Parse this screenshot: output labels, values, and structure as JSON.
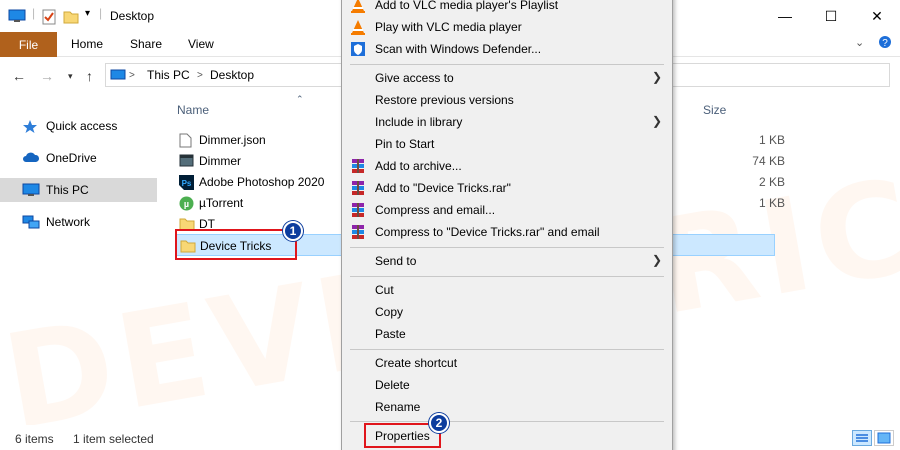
{
  "window": {
    "title": "Desktop",
    "min": "—",
    "max": "☐",
    "close": "✕"
  },
  "ribbon": {
    "tabs": [
      "File",
      "Home",
      "Share",
      "View"
    ]
  },
  "address": {
    "crumbs": [
      "This PC",
      "Desktop"
    ],
    "sep": ">"
  },
  "nav_pane": {
    "items": [
      "Quick access",
      "OneDrive",
      "This PC",
      "Network"
    ],
    "selected": "This PC"
  },
  "columns": {
    "name": "Name",
    "size": "Size"
  },
  "files": [
    {
      "name": "Dimmer.json",
      "size": "1 KB",
      "icon": "document-icon"
    },
    {
      "name": "Dimmer",
      "size": "74 KB",
      "icon": "app-icon"
    },
    {
      "name": "Adobe Photoshop 2020",
      "size": "2 KB",
      "icon": "photoshop-icon"
    },
    {
      "name": "µTorrent",
      "size": "1 KB",
      "icon": "utorrent-icon"
    },
    {
      "name": "DT",
      "size": "",
      "icon": "folder-icon"
    },
    {
      "name": "Device Tricks",
      "size": "",
      "icon": "folder-icon"
    }
  ],
  "selected_file": "Device Tricks",
  "status": {
    "items": "6 items",
    "selected": "1 item selected"
  },
  "context_menu": {
    "items": [
      {
        "label": "Add to VLC media player's Playlist",
        "icon": "vlc-icon",
        "submenu": false
      },
      {
        "label": "Play with VLC media player",
        "icon": "vlc-icon",
        "submenu": false
      },
      {
        "label": "Scan with Windows Defender...",
        "icon": "defender-icon",
        "submenu": false
      },
      {
        "label": "Give access to",
        "icon": "",
        "submenu": true
      },
      {
        "label": "Restore previous versions",
        "icon": "",
        "submenu": false
      },
      {
        "label": "Include in library",
        "icon": "",
        "submenu": true
      },
      {
        "label": "Pin to Start",
        "icon": "",
        "submenu": false
      },
      {
        "label": "Add to archive...",
        "icon": "winrar-icon",
        "submenu": false
      },
      {
        "label": "Add to \"Device Tricks.rar\"",
        "icon": "winrar-icon",
        "submenu": false
      },
      {
        "label": "Compress and email...",
        "icon": "winrar-icon",
        "submenu": false
      },
      {
        "label": "Compress to \"Device Tricks.rar\" and email",
        "icon": "winrar-icon",
        "submenu": false
      },
      {
        "label": "Send to",
        "icon": "",
        "submenu": true
      },
      {
        "label": "Cut",
        "icon": "",
        "submenu": false
      },
      {
        "label": "Copy",
        "icon": "",
        "submenu": false
      },
      {
        "label": "Paste",
        "icon": "",
        "submenu": false
      },
      {
        "label": "Create shortcut",
        "icon": "",
        "submenu": false
      },
      {
        "label": "Delete",
        "icon": "",
        "submenu": false
      },
      {
        "label": "Rename",
        "icon": "",
        "submenu": false
      },
      {
        "label": "Properties",
        "icon": "",
        "submenu": false
      }
    ]
  },
  "annotations": {
    "step1": "1",
    "step2": "2"
  },
  "watermark": "DEVICETRICKS",
  "colors": {
    "file_tab": "#b0611c",
    "selection": "#cce8ff",
    "highlight": "#e0151b",
    "badge": "#0d3d9e"
  }
}
